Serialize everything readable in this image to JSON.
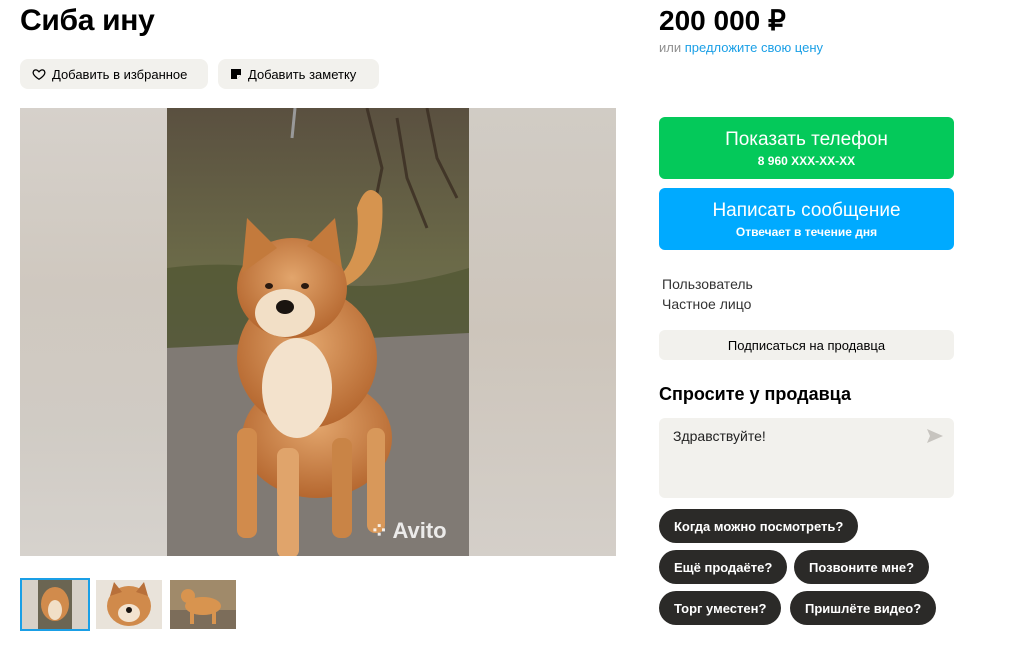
{
  "listing": {
    "title": "Сиба ину",
    "add_favorite_label": "Добавить в избранное",
    "add_note_label": "Добавить заметку",
    "watermark": "Avito"
  },
  "price": {
    "amount": "200 000 ₽",
    "offer_prefix": "или",
    "offer_link": "предложите свою цену"
  },
  "contact": {
    "phone_label": "Показать телефон",
    "phone_number": "8 960 XXX-XX-XX",
    "message_label": "Написать сообщение",
    "message_sub": "Отвечает в течение дня"
  },
  "seller": {
    "name": "Пользователь",
    "type": "Частное лицо",
    "subscribe_label": "Подписаться на продавца"
  },
  "ask": {
    "title": "Спросите у продавца",
    "message": "Здравствуйте!",
    "quick_questions": [
      "Когда можно посмотреть?",
      "Ещё продаёте?",
      "Позвоните мне?",
      "Торг уместен?",
      "Пришлёте видео?"
    ]
  },
  "colors": {
    "phone_button": "#04c95a",
    "message_button": "#00aaff",
    "link": "#1a9fe6",
    "chip": "#2b2a28"
  }
}
